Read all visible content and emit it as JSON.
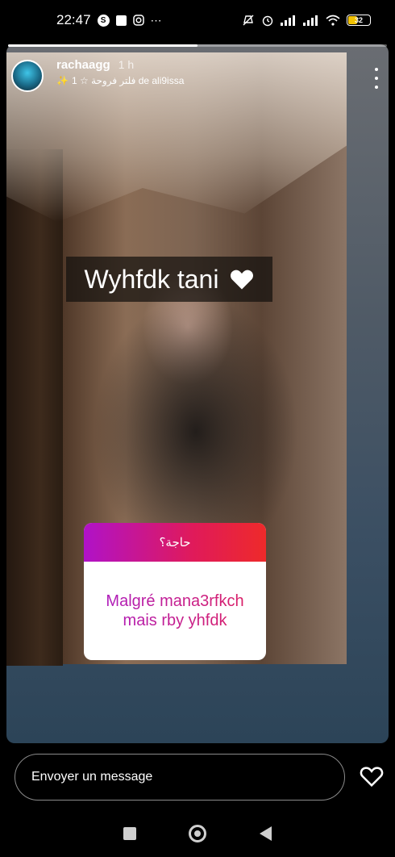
{
  "status_bar": {
    "time": "22:47",
    "battery": "32",
    "left_icons": [
      "s-circle-icon",
      "square-icon",
      "instagram-icon",
      "ellipsis-icon"
    ],
    "right_icons": [
      "mute-icon",
      "alarm-icon",
      "signal-icon",
      "signal-icon",
      "wifi-icon",
      "battery-icon"
    ]
  },
  "story": {
    "progress": 0.5,
    "username": "rachaagg",
    "time_ago": "1 h",
    "sublabel": "فلتر فروحة ☆ 1 de ali9issa",
    "caption": "Wyhfdk tani",
    "question": {
      "prompt": "حاجة؟",
      "answer": "Malgré mana3rfkch mais rby yhfdk"
    }
  },
  "reply": {
    "placeholder": "Envoyer un message"
  },
  "colors": {
    "question_gradient_start": "#b012c8",
    "question_gradient_end": "#ee2a2a",
    "background": "#000000"
  }
}
